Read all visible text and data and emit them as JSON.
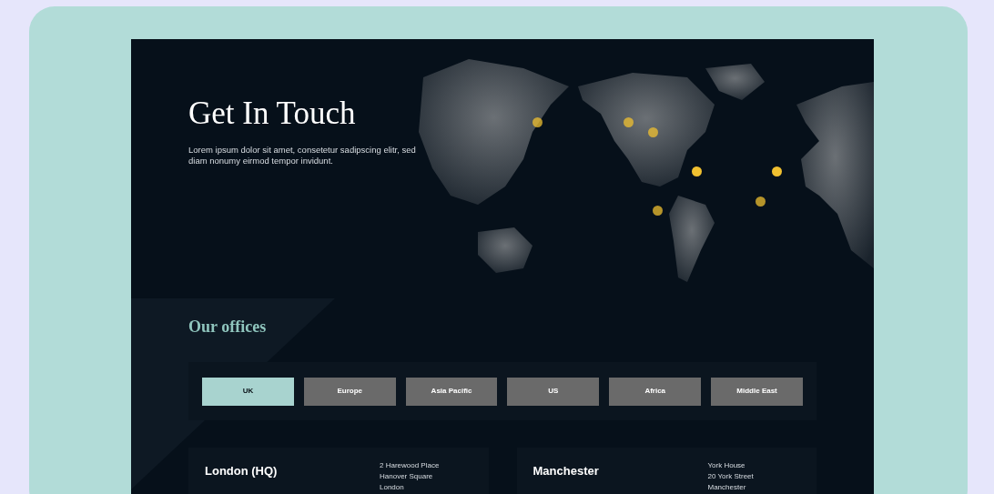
{
  "hero": {
    "title": "Get In Touch",
    "text": "Lorem ipsum dolor sit amet, consetetur sadipscing elitr, sed diam nonumy eirmod tempor invidunt."
  },
  "offices": {
    "heading": "Our offices",
    "tabs": [
      {
        "label": "UK",
        "selected": true
      },
      {
        "label": "Europe",
        "selected": false
      },
      {
        "label": "Asia Pacific",
        "selected": false
      },
      {
        "label": "US",
        "selected": false
      },
      {
        "label": "Africa",
        "selected": false
      },
      {
        "label": "Middle East",
        "selected": false
      }
    ],
    "cards": [
      {
        "name": "London (HQ)",
        "address": [
          "2 Harewood Place",
          "Hanover Square",
          "London"
        ]
      },
      {
        "name": "Manchester",
        "address": [
          "York House",
          "20 York Street",
          "Manchester"
        ]
      }
    ]
  }
}
